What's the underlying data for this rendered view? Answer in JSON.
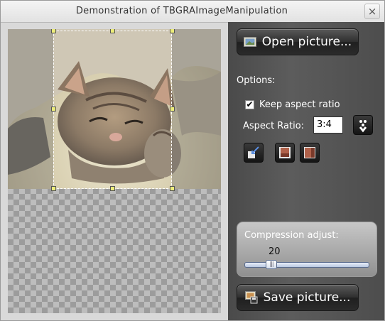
{
  "window": {
    "title": "Demonstration of TBGRAImageManipulation",
    "close_label": "×"
  },
  "panel": {
    "open_button_label": "Open picture...",
    "options_label": "Options:",
    "keep_aspect_label": "Keep aspect ratio",
    "keep_aspect_checked": true,
    "aspect_ratio_label": "Aspect Ratio:",
    "aspect_ratio_value": "3:4",
    "compression_label": "Compression adjust:",
    "compression_value": "20",
    "save_button_label": "Save picture..."
  },
  "icons": {
    "open_button": "picture-open-icon",
    "aspect_apply": "apply-dots-icon",
    "crop_tool_1": "crop-arrow-icon",
    "crop_tool_2": "crop-landscape-icon",
    "crop_tool_3": "crop-portrait-icon",
    "save_button": "picture-save-icon"
  },
  "colors": {
    "panel_bg": "#4f4f4f",
    "handle": "#ecec7a",
    "slider_track": "#b8c6e0"
  }
}
